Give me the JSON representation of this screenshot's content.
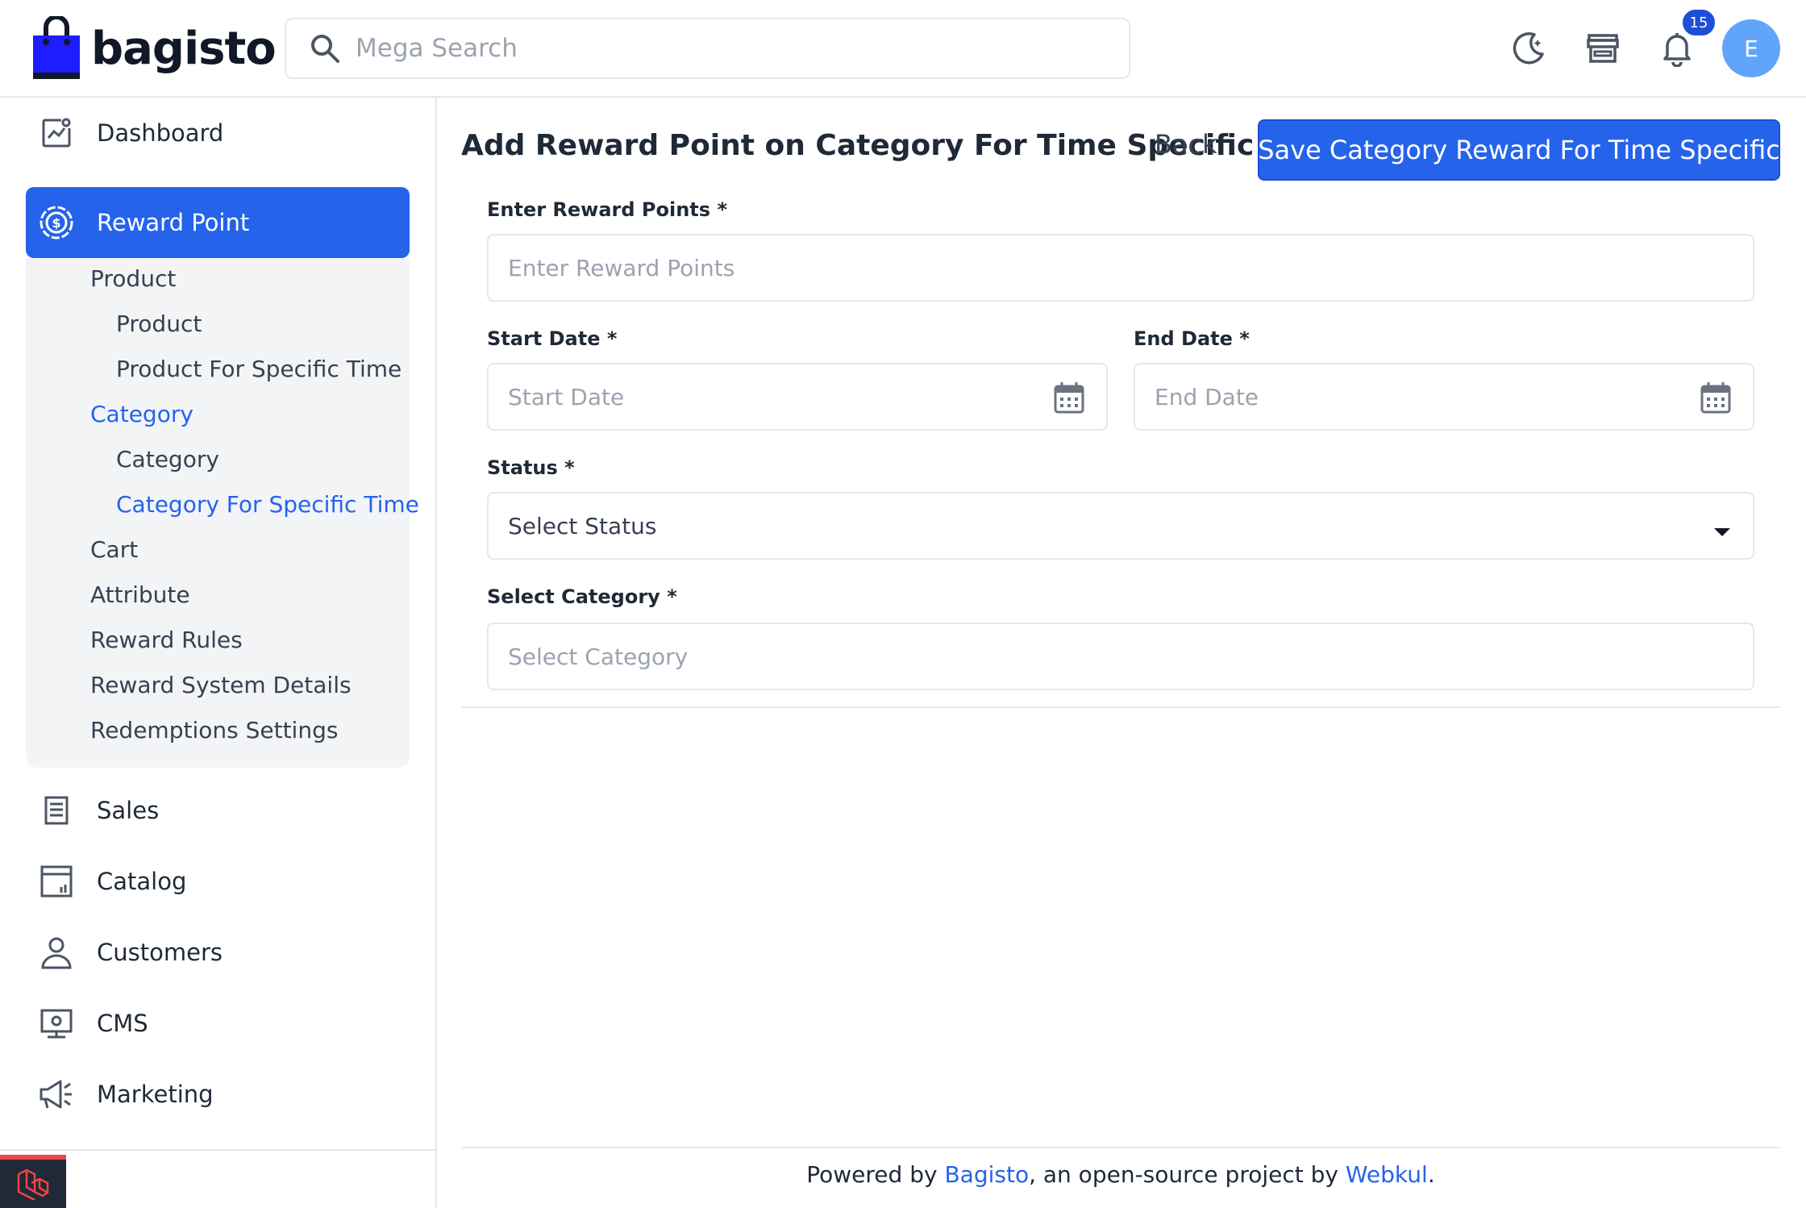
{
  "header": {
    "logo_text": "bagisto",
    "search_placeholder": "Mega Search",
    "notification_count": "15",
    "avatar_initial": "E"
  },
  "sidebar": {
    "dashboard": "Dashboard",
    "reward_point": "Reward Point",
    "submenu": {
      "product_group": "Product",
      "product": "Product",
      "product_specific_time": "Product For Specific Time",
      "category_group": "Category",
      "category": "Category",
      "category_specific_time": "Category For Specific Time",
      "cart": "Cart",
      "attribute": "Attribute",
      "reward_rules": "Reward Rules",
      "reward_system_details": "Reward System Details",
      "redemptions_settings": "Redemptions Settings"
    },
    "sales": "Sales",
    "catalog": "Catalog",
    "customers": "Customers",
    "cms": "CMS",
    "marketing": "Marketing"
  },
  "main": {
    "title": "Add Reward Point on Category For Time Specific",
    "back_label": "Back",
    "save_label": "Save Category Reward For Time Specific",
    "form": {
      "reward_points_label": "Enter Reward Points",
      "reward_points_placeholder": "Enter Reward Points",
      "start_date_label": "Start Date",
      "start_date_placeholder": "Start Date",
      "end_date_label": "End Date",
      "end_date_placeholder": "End Date",
      "status_label": "Status",
      "status_value": "Select Status",
      "category_label": "Select Category",
      "category_placeholder": "Select Category",
      "required_mark": "*"
    }
  },
  "footer": {
    "prefix": "Powered by ",
    "bagisto_link": "Bagisto",
    "middle": ", an open-source project by ",
    "webkul_link": "Webkul",
    "suffix": "."
  },
  "colors": {
    "accent": "#2563eb",
    "submenu_bg": "#f3f4f6",
    "border": "#e5e7eb"
  }
}
